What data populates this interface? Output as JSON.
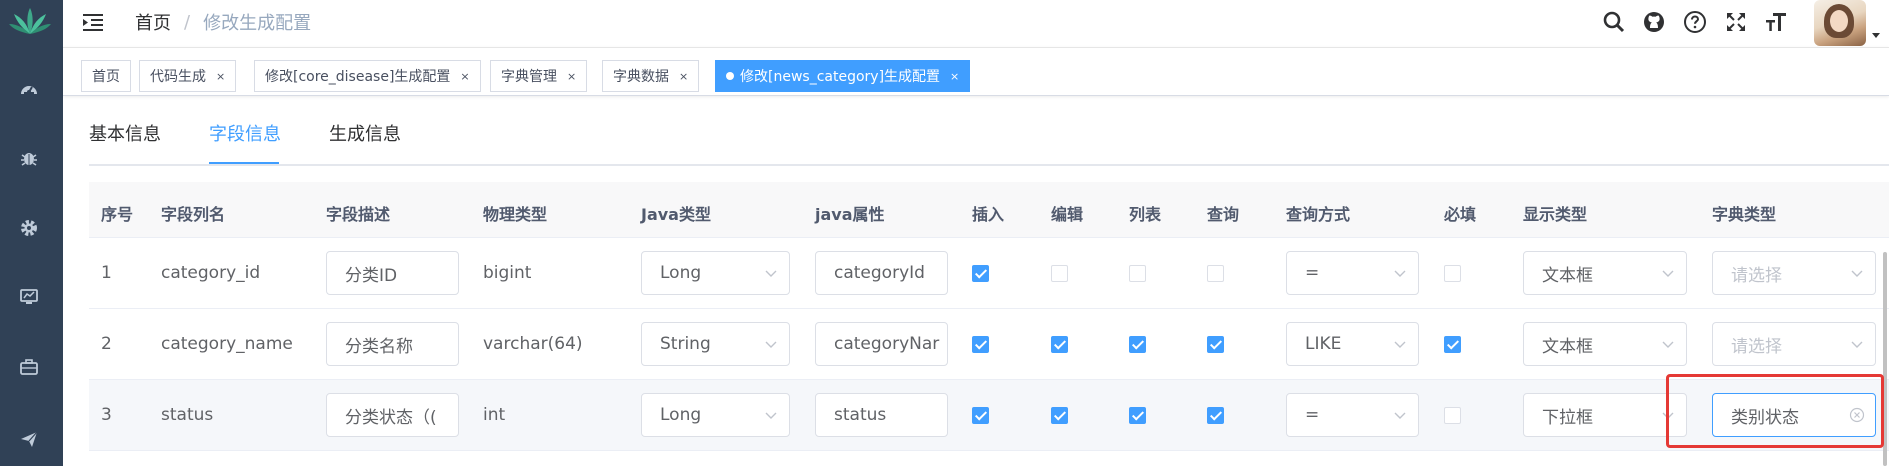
{
  "breadcrumb": {
    "home": "首页",
    "separator": "/",
    "current": "修改生成配置"
  },
  "icons": {
    "sidebar": [
      "dashboard-icon",
      "bug-icon",
      "gear-icon",
      "monitor-icon",
      "toolbox-icon",
      "send-icon"
    ],
    "navbar": [
      "search-icon",
      "github-icon",
      "question-icon",
      "fullscreen-icon",
      "font-size-icon"
    ]
  },
  "tags": [
    {
      "label": "首页",
      "closable": false,
      "active": false
    },
    {
      "label": "代码生成",
      "closable": true,
      "active": false
    },
    {
      "label": "修改[core_disease]生成配置",
      "closable": true,
      "active": false
    },
    {
      "label": "字典管理",
      "closable": true,
      "active": false
    },
    {
      "label": "字典数据",
      "closable": true,
      "active": false
    },
    {
      "label": "修改[news_category]生成配置",
      "closable": true,
      "active": true
    }
  ],
  "tag_close_glyph": "×",
  "tabs": [
    "基本信息",
    "字段信息",
    "生成信息"
  ],
  "active_tab": "字段信息",
  "table": {
    "headers": [
      "序号",
      "字段列名",
      "字段描述",
      "物理类型",
      "Java类型",
      "java属性",
      "插入",
      "编辑",
      "列表",
      "查询",
      "查询方式",
      "必填",
      "显示类型",
      "字典类型"
    ],
    "rows": [
      {
        "index": "1",
        "column": "category_id",
        "desc": "分类ID",
        "physical": "bigint",
        "java_type": "Long",
        "java_prop": "categoryId",
        "insert": true,
        "edit": false,
        "list": false,
        "query": false,
        "query_type": "=",
        "required": false,
        "display": "文本框",
        "dict": "",
        "dict_placeholder": "请选择"
      },
      {
        "index": "2",
        "column": "category_name",
        "desc": "分类名称",
        "physical": "varchar(64)",
        "java_type": "String",
        "java_prop": "categoryNar",
        "insert": true,
        "edit": true,
        "list": true,
        "query": true,
        "query_type": "LIKE",
        "required": true,
        "display": "文本框",
        "dict": "",
        "dict_placeholder": "请选择"
      },
      {
        "index": "3",
        "column": "status",
        "desc": "分类状态（(",
        "physical": "int",
        "java_type": "Long",
        "java_prop": "status",
        "insert": true,
        "edit": true,
        "list": true,
        "query": true,
        "query_type": "=",
        "required": false,
        "display": "下拉框",
        "dict": "类别状态",
        "dict_placeholder": "请选择"
      }
    ]
  },
  "colors": {
    "primary": "#409eff",
    "sidebar": "#304156",
    "highlight": "#e53935"
  }
}
